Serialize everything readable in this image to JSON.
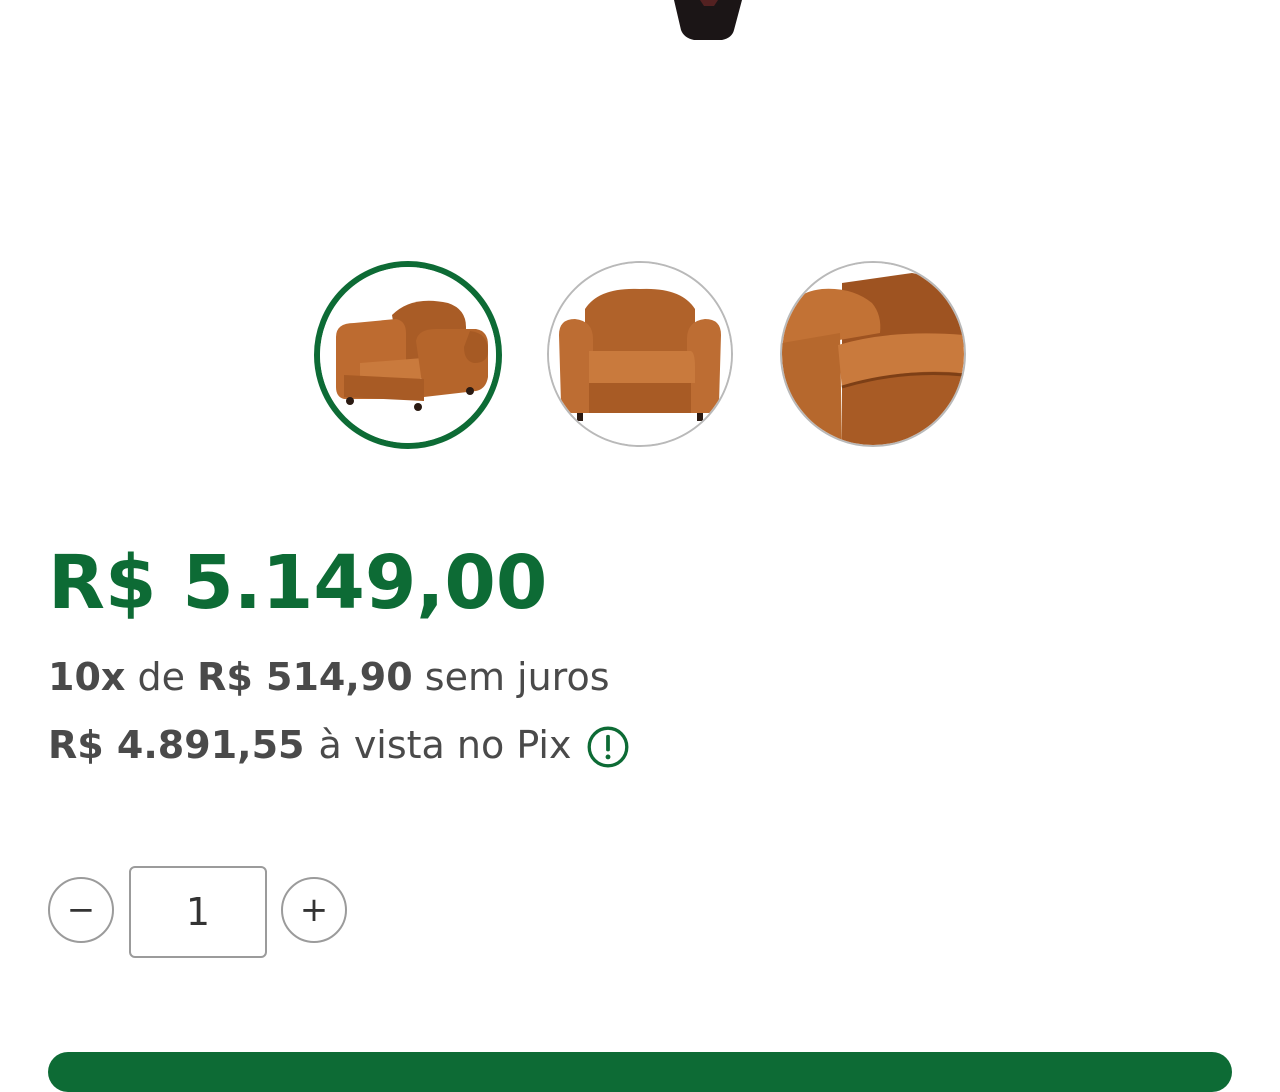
{
  "product": {
    "images": [
      {
        "icon": "armchair-angled-view"
      },
      {
        "icon": "armchair-front-view"
      },
      {
        "icon": "armchair-detail-view"
      }
    ],
    "active_image_index": 0
  },
  "pricing": {
    "price": "R$ 5.149,00",
    "installments_count": "10x",
    "installments_de": "de",
    "installment_value": "R$ 514,90",
    "installments_suffix": "sem juros",
    "pix_price": "R$ 4.891,55",
    "pix_suffix": "à vista no Pix"
  },
  "quantity": {
    "value": "1",
    "minus_label": "−",
    "plus_label": "+"
  },
  "colors": {
    "brand_green": "#0d6b35",
    "leather": "#b8672c",
    "text": "#4a4a4a"
  }
}
